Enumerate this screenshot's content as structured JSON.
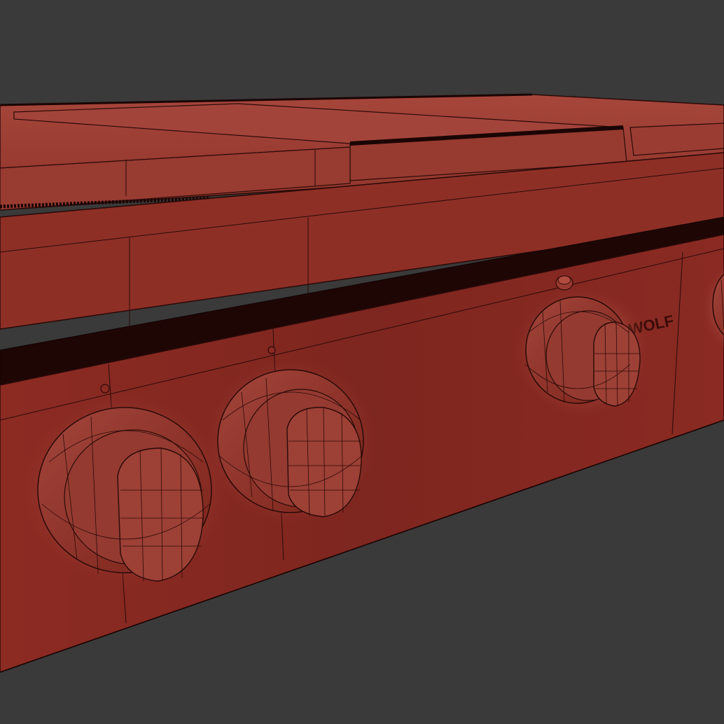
{
  "scene": {
    "background_color": "#3a3a3a",
    "object_color": "#8a2a22",
    "object_highlight_color": "#a8443a",
    "wire_color": "#2a0a08",
    "brand_text": "WOLF"
  },
  "knobs": [
    {
      "name": "knob-1"
    },
    {
      "name": "knob-2"
    },
    {
      "name": "knob-3"
    },
    {
      "name": "knob-4-partial"
    }
  ]
}
